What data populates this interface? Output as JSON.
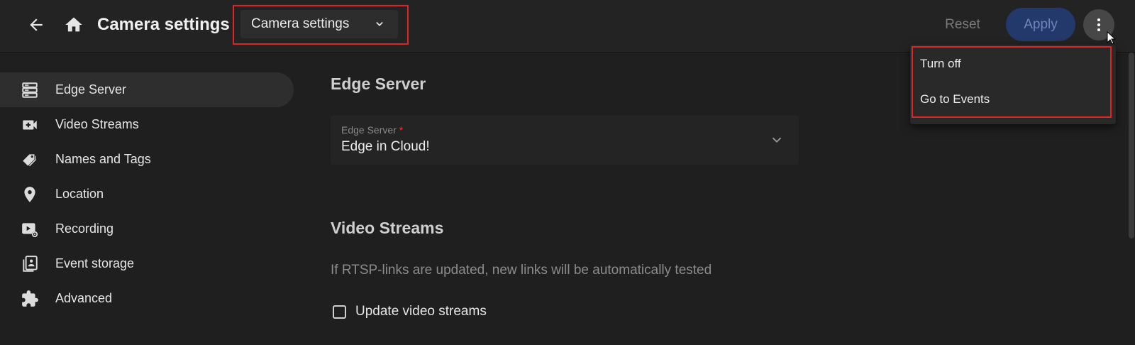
{
  "header": {
    "title": "Camera settings",
    "section_dropdown": {
      "selected": "Camera settings"
    },
    "reset_label": "Reset",
    "apply_label": "Apply"
  },
  "menu": {
    "items": [
      {
        "label": "Turn off"
      },
      {
        "label": "Go to Events"
      }
    ]
  },
  "sidebar": {
    "active_index": 0,
    "items": [
      {
        "label": "Edge Server",
        "icon": "server-icon"
      },
      {
        "label": "Video Streams",
        "icon": "video-add-icon"
      },
      {
        "label": "Names and Tags",
        "icon": "tags-icon"
      },
      {
        "label": "Location",
        "icon": "location-pin-icon"
      },
      {
        "label": "Recording",
        "icon": "recording-settings-icon"
      },
      {
        "label": "Event storage",
        "icon": "event-storage-icon"
      },
      {
        "label": "Advanced",
        "icon": "puzzle-icon"
      }
    ]
  },
  "main": {
    "edge_section": {
      "title": "Edge Server",
      "field_label": "Edge Server",
      "required_mark": "*",
      "field_value": "Edge in Cloud!"
    },
    "streams_section": {
      "title": "Video Streams",
      "hint": "If RTSP-links are updated, new links will be automatically tested",
      "checkbox_label": "Update video streams",
      "checkbox_checked": false
    }
  },
  "colors": {
    "background": "#1f1f1f",
    "topbar": "#232323",
    "apply_button": "#23386b",
    "highlight_outline": "#e02424",
    "required": "#e53935"
  }
}
